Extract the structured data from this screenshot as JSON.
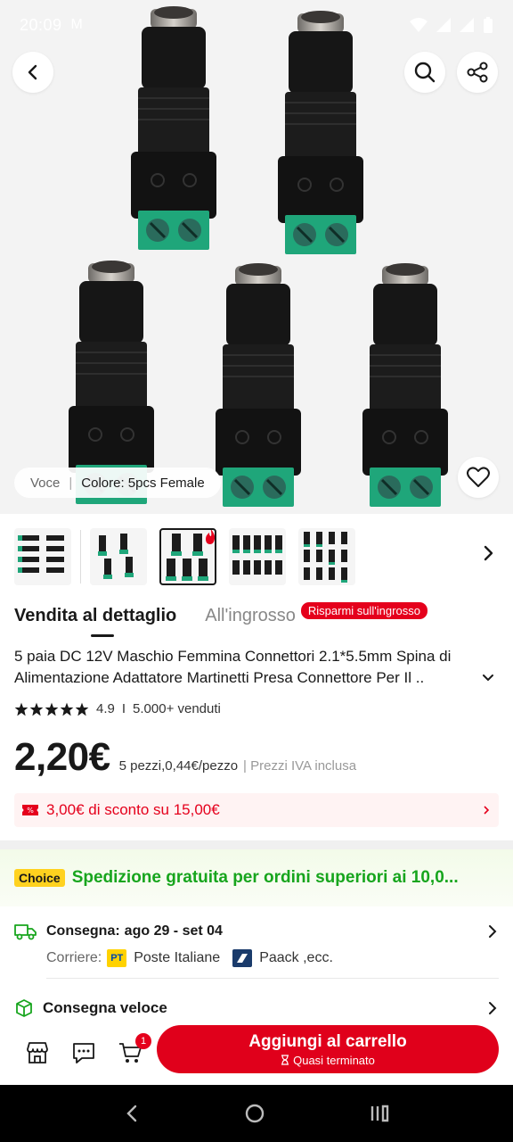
{
  "status_bar": {
    "time": "20:09",
    "mail_icon": "M"
  },
  "hero": {
    "variant_label": "Voce",
    "variant_value": "Colore: 5pcs Female"
  },
  "tabs": {
    "retail": "Vendita al dettaglio",
    "wholesale": "All'ingrosso",
    "wholesale_badge": "Risparmi sull'ingrosso"
  },
  "product": {
    "title": "5 paia DC 12V Maschio Femmina Connettori 2.1*5.5mm Spina di Alimentazione Adattatore Martinetti Presa Connettore Per Il ..",
    "rating": "4.9",
    "sold": "5.000+ venduti",
    "price": "2,20€",
    "unit_price": "5 pezzi,0,44€/pezzo",
    "vat_note": "| Prezzi IVA inclusa",
    "coupon": "3,00€ di sconto su 15,00€"
  },
  "shipping": {
    "choice_badge": "Choice",
    "choice_text": "Spedizione gratuita per ordini superiori ai 10,0...",
    "delivery_label": "Consegna:",
    "delivery_dates": "ago 29 - set 04",
    "carrier_label": "Corriere:",
    "carrier_1_logo": "PT",
    "carrier_1": "Poste Italiane",
    "carrier_2": "Paack ,ecc.",
    "fast_delivery": "Consegna veloce"
  },
  "bottom_bar": {
    "cart_count": "1",
    "add_to_cart": "Aggiungi al carrello",
    "stock_note": "Quasi terminato"
  },
  "colors": {
    "accent_red": "#e0001b",
    "choice_green": "#17a51d",
    "connector_green": "#1fa67a"
  }
}
